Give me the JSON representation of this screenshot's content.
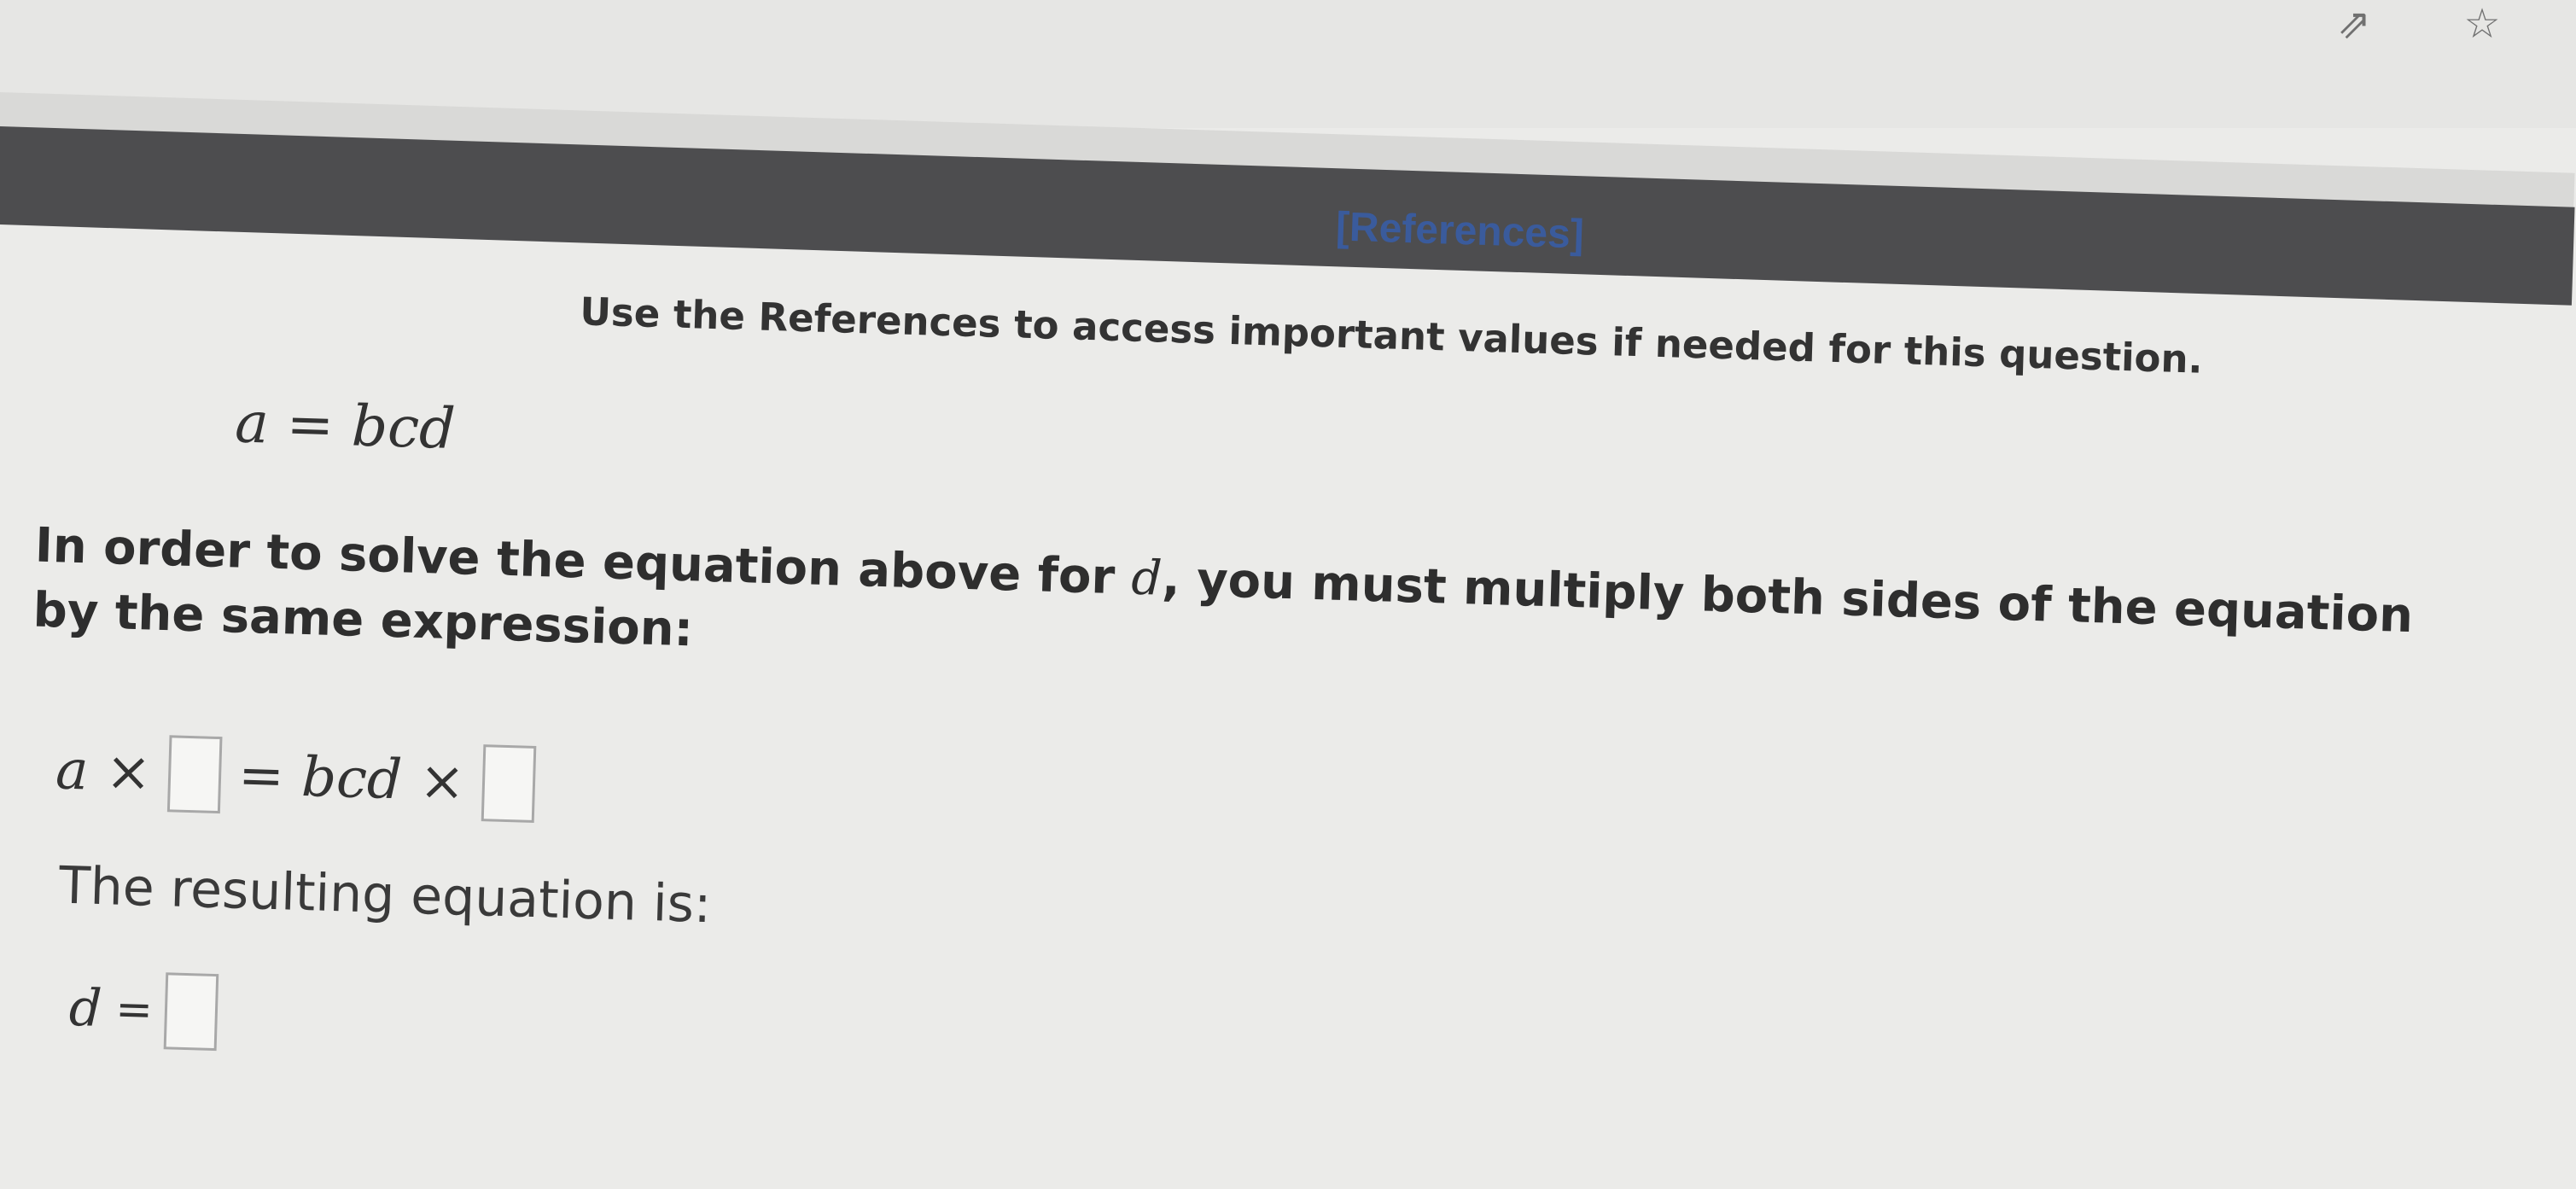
{
  "browser": {
    "share_icon": "share-icon",
    "star_icon": "star-icon"
  },
  "references": {
    "link_label": "[References]",
    "instruction": "Use the References to access important values if needed for this question."
  },
  "given_equation": "a = bcd",
  "question": {
    "prompt_before": "In order to solve the equation above for ",
    "variable": "d",
    "prompt_after": ", you must multiply both sides of the equation by the same expression:"
  },
  "multiplication_step": {
    "left": "a ×",
    "middle": "= bcd ×",
    "box_left_value": "",
    "box_right_value": ""
  },
  "result": {
    "label": "The resulting equation is:",
    "variable": "d",
    "equals": "=",
    "box_value": ""
  },
  "colors": {
    "reference_bar": "#4d4d4f",
    "reference_link": "#3a5b9c",
    "background": "#ebebe9"
  }
}
